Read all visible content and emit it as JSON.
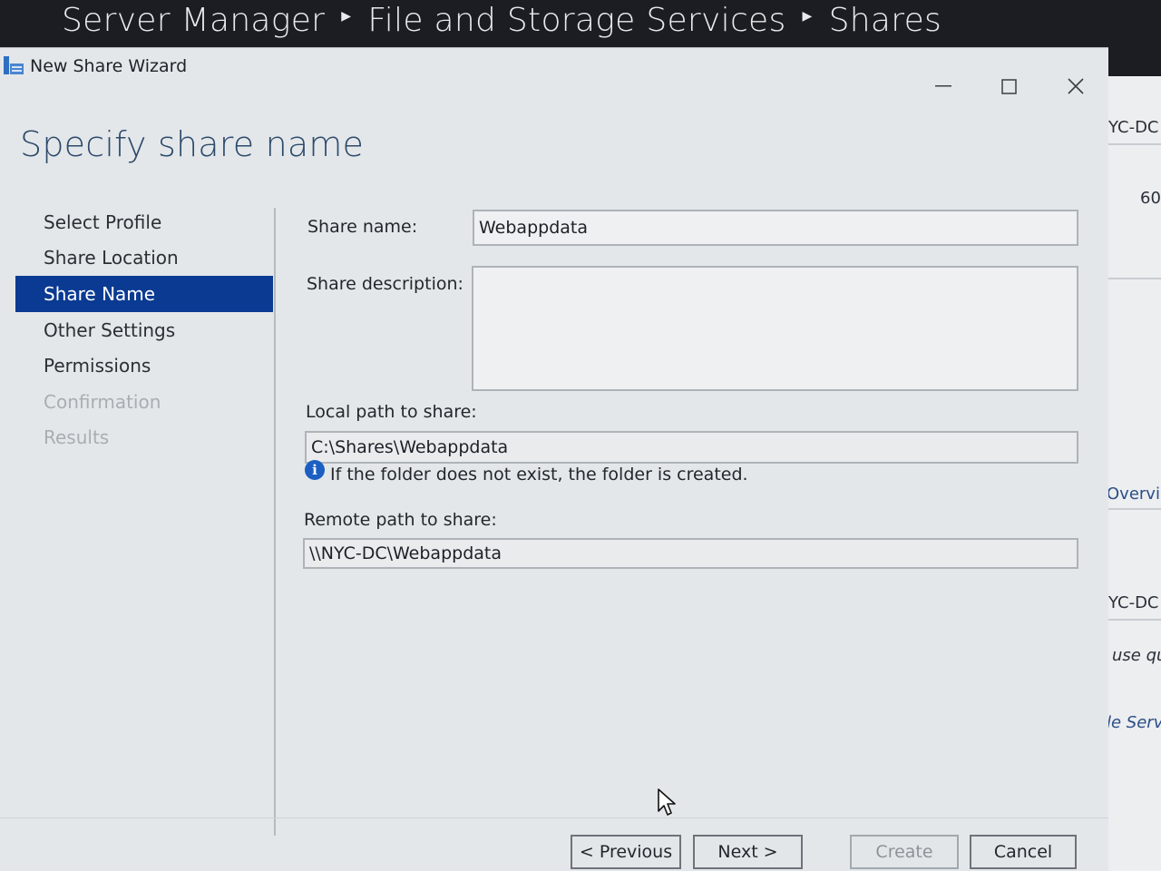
{
  "server_manager": {
    "breadcrumb": [
      "Server Manager",
      "File and Storage Services",
      "Shares"
    ]
  },
  "background_panel": {
    "server_name_top": "YC-DC",
    "count": "60",
    "overview": "Overvie",
    "server_name_bottom": "YC-DC",
    "use_text": "use qu",
    "file_server_text": "le Serve"
  },
  "wizard": {
    "title": "New Share Wizard",
    "heading": "Specify share name",
    "steps": [
      {
        "label": "Select Profile",
        "state": "normal"
      },
      {
        "label": "Share Location",
        "state": "normal"
      },
      {
        "label": "Share Name",
        "state": "active"
      },
      {
        "label": "Other Settings",
        "state": "normal"
      },
      {
        "label": "Permissions",
        "state": "normal"
      },
      {
        "label": "Confirmation",
        "state": "disabled"
      },
      {
        "label": "Results",
        "state": "disabled"
      }
    ],
    "form": {
      "share_name_label": "Share name:",
      "share_name_value": "Webappdata",
      "share_description_label": "Share description:",
      "share_description_value": "",
      "local_path_label": "Local path to share:",
      "local_path_value": "C:\\Shares\\Webappdata",
      "info_text": "If the folder does not exist, the folder is created.",
      "remote_path_label": "Remote path to share:",
      "remote_path_value": "\\\\NYC-DC\\Webappdata"
    },
    "buttons": {
      "previous": "< Previous",
      "next": "Next >",
      "create": "Create",
      "cancel": "Cancel"
    }
  },
  "colors": {
    "active_step": "#0a3a92",
    "heading": "#2c4a6b",
    "info_icon": "#1b5fc2"
  }
}
